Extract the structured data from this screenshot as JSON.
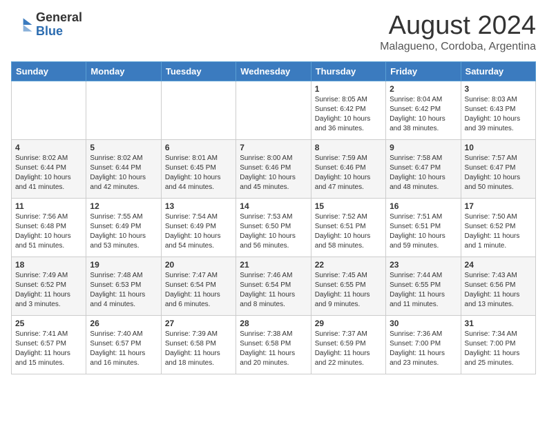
{
  "logo": {
    "general": "General",
    "blue": "Blue"
  },
  "title": "August 2024",
  "subtitle": "Malagueno, Cordoba, Argentina",
  "days_header": [
    "Sunday",
    "Monday",
    "Tuesday",
    "Wednesday",
    "Thursday",
    "Friday",
    "Saturday"
  ],
  "weeks": [
    [
      {
        "day": "",
        "info": ""
      },
      {
        "day": "",
        "info": ""
      },
      {
        "day": "",
        "info": ""
      },
      {
        "day": "",
        "info": ""
      },
      {
        "day": "1",
        "info": "Sunrise: 8:05 AM\nSunset: 6:42 PM\nDaylight: 10 hours\nand 36 minutes."
      },
      {
        "day": "2",
        "info": "Sunrise: 8:04 AM\nSunset: 6:42 PM\nDaylight: 10 hours\nand 38 minutes."
      },
      {
        "day": "3",
        "info": "Sunrise: 8:03 AM\nSunset: 6:43 PM\nDaylight: 10 hours\nand 39 minutes."
      }
    ],
    [
      {
        "day": "4",
        "info": "Sunrise: 8:02 AM\nSunset: 6:44 PM\nDaylight: 10 hours\nand 41 minutes."
      },
      {
        "day": "5",
        "info": "Sunrise: 8:02 AM\nSunset: 6:44 PM\nDaylight: 10 hours\nand 42 minutes."
      },
      {
        "day": "6",
        "info": "Sunrise: 8:01 AM\nSunset: 6:45 PM\nDaylight: 10 hours\nand 44 minutes."
      },
      {
        "day": "7",
        "info": "Sunrise: 8:00 AM\nSunset: 6:46 PM\nDaylight: 10 hours\nand 45 minutes."
      },
      {
        "day": "8",
        "info": "Sunrise: 7:59 AM\nSunset: 6:46 PM\nDaylight: 10 hours\nand 47 minutes."
      },
      {
        "day": "9",
        "info": "Sunrise: 7:58 AM\nSunset: 6:47 PM\nDaylight: 10 hours\nand 48 minutes."
      },
      {
        "day": "10",
        "info": "Sunrise: 7:57 AM\nSunset: 6:47 PM\nDaylight: 10 hours\nand 50 minutes."
      }
    ],
    [
      {
        "day": "11",
        "info": "Sunrise: 7:56 AM\nSunset: 6:48 PM\nDaylight: 10 hours\nand 51 minutes."
      },
      {
        "day": "12",
        "info": "Sunrise: 7:55 AM\nSunset: 6:49 PM\nDaylight: 10 hours\nand 53 minutes."
      },
      {
        "day": "13",
        "info": "Sunrise: 7:54 AM\nSunset: 6:49 PM\nDaylight: 10 hours\nand 54 minutes."
      },
      {
        "day": "14",
        "info": "Sunrise: 7:53 AM\nSunset: 6:50 PM\nDaylight: 10 hours\nand 56 minutes."
      },
      {
        "day": "15",
        "info": "Sunrise: 7:52 AM\nSunset: 6:51 PM\nDaylight: 10 hours\nand 58 minutes."
      },
      {
        "day": "16",
        "info": "Sunrise: 7:51 AM\nSunset: 6:51 PM\nDaylight: 10 hours\nand 59 minutes."
      },
      {
        "day": "17",
        "info": "Sunrise: 7:50 AM\nSunset: 6:52 PM\nDaylight: 11 hours\nand 1 minute."
      }
    ],
    [
      {
        "day": "18",
        "info": "Sunrise: 7:49 AM\nSunset: 6:52 PM\nDaylight: 11 hours\nand 3 minutes."
      },
      {
        "day": "19",
        "info": "Sunrise: 7:48 AM\nSunset: 6:53 PM\nDaylight: 11 hours\nand 4 minutes."
      },
      {
        "day": "20",
        "info": "Sunrise: 7:47 AM\nSunset: 6:54 PM\nDaylight: 11 hours\nand 6 minutes."
      },
      {
        "day": "21",
        "info": "Sunrise: 7:46 AM\nSunset: 6:54 PM\nDaylight: 11 hours\nand 8 minutes."
      },
      {
        "day": "22",
        "info": "Sunrise: 7:45 AM\nSunset: 6:55 PM\nDaylight: 11 hours\nand 9 minutes."
      },
      {
        "day": "23",
        "info": "Sunrise: 7:44 AM\nSunset: 6:55 PM\nDaylight: 11 hours\nand 11 minutes."
      },
      {
        "day": "24",
        "info": "Sunrise: 7:43 AM\nSunset: 6:56 PM\nDaylight: 11 hours\nand 13 minutes."
      }
    ],
    [
      {
        "day": "25",
        "info": "Sunrise: 7:41 AM\nSunset: 6:57 PM\nDaylight: 11 hours\nand 15 minutes."
      },
      {
        "day": "26",
        "info": "Sunrise: 7:40 AM\nSunset: 6:57 PM\nDaylight: 11 hours\nand 16 minutes."
      },
      {
        "day": "27",
        "info": "Sunrise: 7:39 AM\nSunset: 6:58 PM\nDaylight: 11 hours\nand 18 minutes."
      },
      {
        "day": "28",
        "info": "Sunrise: 7:38 AM\nSunset: 6:58 PM\nDaylight: 11 hours\nand 20 minutes."
      },
      {
        "day": "29",
        "info": "Sunrise: 7:37 AM\nSunset: 6:59 PM\nDaylight: 11 hours\nand 22 minutes."
      },
      {
        "day": "30",
        "info": "Sunrise: 7:36 AM\nSunset: 7:00 PM\nDaylight: 11 hours\nand 23 minutes."
      },
      {
        "day": "31",
        "info": "Sunrise: 7:34 AM\nSunset: 7:00 PM\nDaylight: 11 hours\nand 25 minutes."
      }
    ]
  ]
}
